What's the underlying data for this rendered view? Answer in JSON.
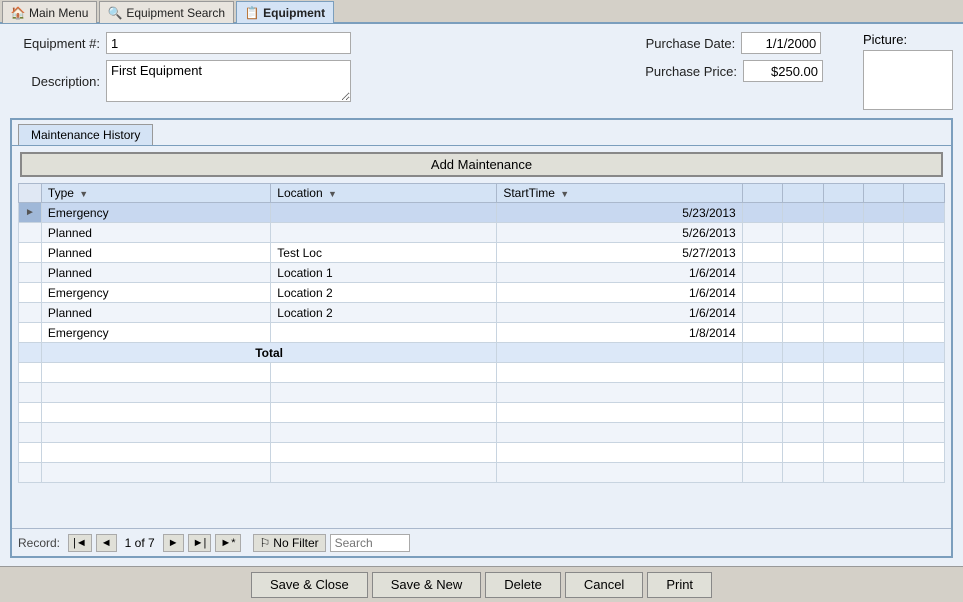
{
  "tabs": [
    {
      "id": "main-menu",
      "label": "Main Menu",
      "icon": "🏠",
      "active": false
    },
    {
      "id": "equipment-search",
      "label": "Equipment Search",
      "icon": "🔍",
      "active": false
    },
    {
      "id": "equipment",
      "label": "Equipment",
      "icon": "📋",
      "active": true
    }
  ],
  "form": {
    "equipment_num_label": "Equipment #:",
    "equipment_num_value": "1",
    "description_label": "Description:",
    "description_value": "First Equipment",
    "purchase_date_label": "Purchase Date:",
    "purchase_date_value": "1/1/2000",
    "purchase_price_label": "Purchase Price:",
    "purchase_price_value": "$250.00",
    "picture_label": "Picture:"
  },
  "maintenance": {
    "section_tab_label": "Maintenance History",
    "add_button_label": "Add Maintenance",
    "columns": [
      {
        "id": "type",
        "label": "Type"
      },
      {
        "id": "location",
        "label": "Location"
      },
      {
        "id": "starttime",
        "label": "StartTime"
      }
    ],
    "rows": [
      {
        "type": "Emergency",
        "location": "",
        "starttime": "5/23/2013",
        "selected": true
      },
      {
        "type": "Planned",
        "location": "",
        "starttime": "5/26/2013",
        "selected": false
      },
      {
        "type": "Planned",
        "location": "Test Loc",
        "starttime": "5/27/2013",
        "selected": false
      },
      {
        "type": "Planned",
        "location": "Location 1",
        "starttime": "1/6/2014",
        "selected": false
      },
      {
        "type": "Emergency",
        "location": "Location 2",
        "starttime": "1/6/2014",
        "selected": false
      },
      {
        "type": "Planned",
        "location": "Location 2",
        "starttime": "1/6/2014",
        "selected": false
      },
      {
        "type": "Emergency",
        "location": "",
        "starttime": "1/8/2014",
        "selected": false
      }
    ],
    "total_label": "Total",
    "record_label": "Record:",
    "record_info": "1 of 7",
    "no_filter_label": "No Filter",
    "search_placeholder": "Search"
  },
  "buttons": {
    "save_close": "Save & Close",
    "save_new": "Save & New",
    "delete": "Delete",
    "cancel": "Cancel",
    "print": "Print"
  }
}
